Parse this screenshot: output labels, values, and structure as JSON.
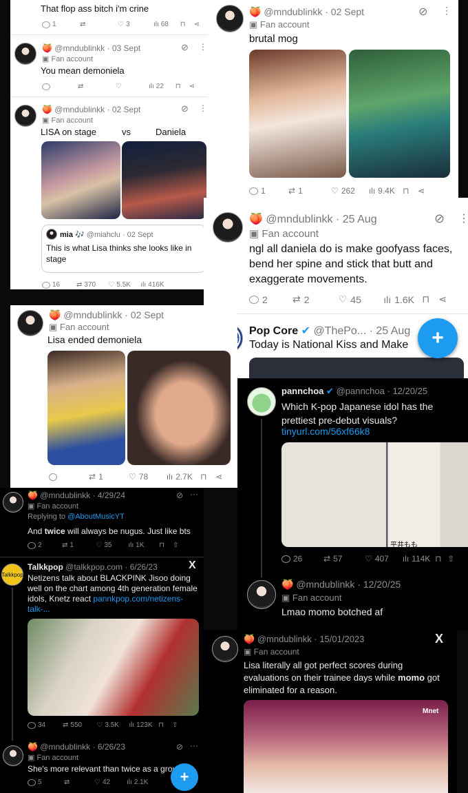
{
  "icons": {
    "reply": "speech-bubble-icon",
    "repost": "repost-arrows-icon",
    "like": "heart-icon",
    "views": "bar-chart-icon",
    "bookmark": "bookmark-icon",
    "share": "share-icon",
    "grok": "grok-icon",
    "more": "more-dots-icon",
    "badge": "fan-account-badge-icon",
    "emoji": "peach-emoji-icon",
    "verified": "verified-check-icon",
    "x_logo": "x-logo-icon",
    "fab": "compose-plus-icon"
  },
  "colors": {
    "accent": "#1d9bf0",
    "light_bg": "#ffffff",
    "dark_bg": "#000000"
  },
  "p1": {
    "top_text": "That flop ass bitch i'm crine",
    "top_stats": {
      "reply": "1",
      "repost": "",
      "like": "3",
      "views": "68"
    },
    "t2": {
      "handle": "@mndublinkk",
      "date": "· 03 Sept",
      "badge": "Fan account",
      "text": "You mean demoniela",
      "stats": {
        "views": "22"
      }
    },
    "t3": {
      "handle": "@mndublinkk",
      "date": "· 02 Sept",
      "badge": "Fan account",
      "text_a": "LISA on stage",
      "text_b": "vs",
      "text_c": "Daniela"
    },
    "quote": {
      "name": "mia",
      "emoji": "🎶",
      "handle": "@miahclu",
      "date": "· 02 Sept",
      "text": "This is what Lisa thinks she looks like in stage"
    },
    "t3_stats": {
      "reply": "16",
      "repost": "370",
      "like": "5.5K",
      "views": "416K"
    }
  },
  "p2": {
    "handle": "@mndublinkk",
    "date": "· 02 Sept",
    "badge": "Fan account",
    "text": "brutal mog",
    "stats": {
      "reply": "1",
      "repost": "1",
      "like": "262",
      "views": "9.4K"
    }
  },
  "p3": {
    "handle": "@mndublinkk",
    "date": "· 25 Aug",
    "badge": "Fan account",
    "text": "ngl all daniela do is make goofyass faces, bend her spine and stick that butt and exaggerate movements.",
    "stats": {
      "reply": "2",
      "repost": "2",
      "like": "45",
      "views": "1.6K"
    },
    "next": {
      "name": "Pop Core",
      "handle": "@ThePo...",
      "date": "· 25 Aug",
      "text": "Today is National Kiss and Make",
      "avatar": "POP CORE"
    },
    "fab": "+"
  },
  "p4": {
    "handle": "@mndublinkk",
    "date": "· 02 Sept",
    "badge": "Fan account",
    "text": "Lisa ended demoniela",
    "stats": {
      "repost": "1",
      "like": "78",
      "views": "2.7K"
    }
  },
  "p5": {
    "t1": {
      "handle": "@mndublinkk",
      "date": "· 4/29/24",
      "badge": "Fan account",
      "replying": "Replying to",
      "replying_to": "@AboutMusicYT",
      "text_a": "And ",
      "text_b": "twice",
      "text_c": " will always be nugus. Just like bts",
      "stats": {
        "reply": "2",
        "repost": "1",
        "like": "35",
        "views": "1K"
      }
    },
    "t2": {
      "name": "Talkkpop",
      "handle": "@talkkpop.com",
      "date": "· 6/26/23",
      "avatar": "Talkkpop",
      "text": "Netizens talk about BLACKPINK Jisoo doing well on the chart among 4th generation female idols, Knetz react ",
      "link": "pannkpop.com/netizens-talk-...",
      "stats": {
        "reply": "34",
        "repost": "550",
        "like": "3.5K",
        "views": "123K"
      }
    },
    "t3": {
      "handle": "@mndublinkk",
      "date": "· 6/26/23",
      "badge": "Fan account",
      "text": "She's more relevant than twice as a grou",
      "stats": {
        "reply": "5",
        "like": "42",
        "views": "2.1K"
      }
    },
    "fab": "+"
  },
  "p6": {
    "t1": {
      "name": "pannchoa",
      "handle": "@pannchoa",
      "date": "· 12/20/25",
      "text": "Which K-pop Japanese idol has the prettiest pre-debut visuals?",
      "link": "tinyurl.com/56xf66k8",
      "stats": {
        "reply": "26",
        "repost": "57",
        "like": "407",
        "views": "114K"
      },
      "img_caption": "平井もも"
    },
    "t2": {
      "handle": "@mndublinkk",
      "date": "· 12/20/25",
      "badge": "Fan account",
      "text": "Lmao momo botched af"
    }
  },
  "p7": {
    "handle": "@mndublinkk",
    "date": "· 15/01/2023",
    "badge": "Fan account",
    "text_a": "Lisa literally all got perfect scores during evaluations on their trainee days while ",
    "text_b": "momo",
    "text_c": " got eliminated for a reason.",
    "broadcaster": "Mnet"
  }
}
